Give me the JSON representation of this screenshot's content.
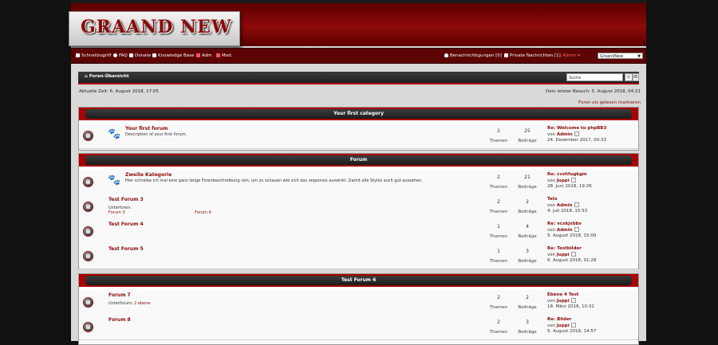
{
  "header": {
    "logo_text": "GRAAND NEW"
  },
  "navbar": {
    "quicklinks": "Schnellzugriff",
    "faq": "FAQ",
    "donate": "Donate",
    "knowledge_base": "Knowledge Base",
    "adm": "Adm.",
    "mod": "Mod.",
    "notifications": "Benachrichtigungen [0]",
    "private_messages": "Private Nachrichten [1]",
    "user": "Admin",
    "style_select": "GraandNew"
  },
  "breadcrumb": {
    "label": "Foren-Übersicht"
  },
  "search": {
    "placeholder": "Suche"
  },
  "meta": {
    "current_time": "Aktuelle Zeit: 6. August 2018, 17:05",
    "last_visit": "Dein letzter Besuch: 5. August 2018, 04:21",
    "mark_read": "Foren als gelesen markieren"
  },
  "labels": {
    "topics": "Themen",
    "posts": "Beiträge",
    "by": "von",
    "subforums": "Unterforen:",
    "subforum": "Unterforum:"
  },
  "categories": [
    {
      "name": "Your first category",
      "forums": [
        {
          "title": "Your first forum",
          "desc": "Description of your first forum.",
          "topics": "2",
          "posts": "25",
          "last_title": "Re: Welcome to phpBB3",
          "last_user": "Admin",
          "last_date": "24. Dezember 2017, 00:33"
        }
      ]
    },
    {
      "name": "Forum",
      "forums": [
        {
          "title": "Zweite Kategorie",
          "desc": "Hier schreibe ich mal eine ganz lange Forenbeschreibung rein, um zu schauen wie sich das responsiv auswirkt. Damit alle Styles auch gut aussehen.",
          "topics": "2",
          "posts": "21",
          "last_title": "Re: cvzhfugkgm",
          "last_user": "Juppi",
          "last_date": "28. Juni 2018, 19:26"
        },
        {
          "title": "Test Forum 3",
          "sub_a": "Forum 3",
          "sub_b": "Forum 4",
          "topics": "2",
          "posts": "2",
          "last_title": "Tets",
          "last_user": "Admin",
          "last_date": "4. Juli 2018, 15:53"
        },
        {
          "title": "Test Forum 4",
          "topics": "1",
          "posts": "4",
          "last_title": "Re: vcxkjxbbv",
          "last_user": "Admin",
          "last_date": "5. August 2018, 15:00"
        },
        {
          "title": "Test Forum 5",
          "topics": "1",
          "posts": "3",
          "last_title": "Re: Testbilder",
          "last_user": "Juppi",
          "last_date": "6. August 2018, 01:28"
        }
      ]
    },
    {
      "name": "Test Forum 6",
      "forums": [
        {
          "title": "Forum 7",
          "sub_a": "2 ebene",
          "topics": "2",
          "posts": "2",
          "last_title": "Ebene 4 Test",
          "last_user": "Juppi",
          "last_date": "18. März 2018, 10:31"
        },
        {
          "title": "Forum 8",
          "topics": "2",
          "posts": "3",
          "last_title": "Re: Bilder",
          "last_user": "Juppi",
          "last_date": "5. August 2018, 14:57"
        }
      ]
    }
  ]
}
